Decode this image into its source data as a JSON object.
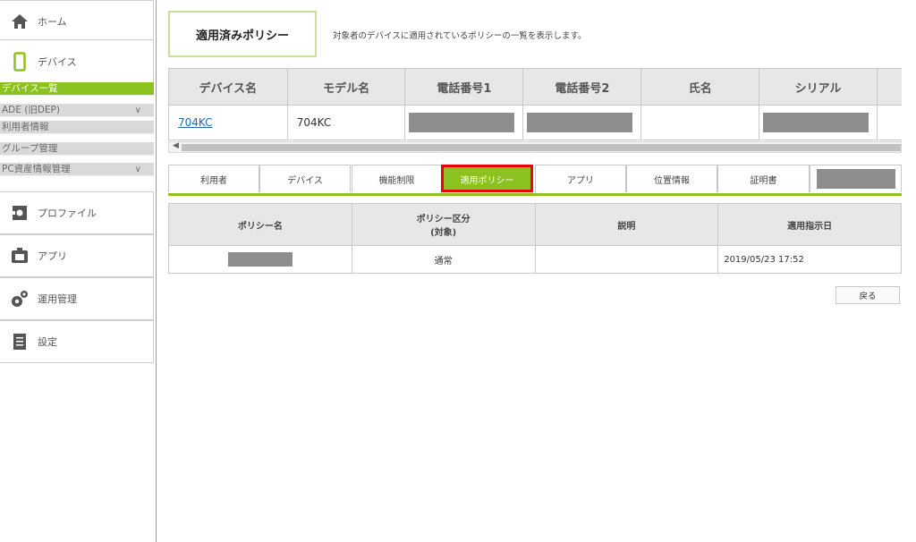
{
  "sidebar": {
    "home": "ホーム",
    "device": "デバイス",
    "sub_items": [
      {
        "label": "デバイス一覧",
        "active": true,
        "chevron": false
      },
      {
        "label": "ADE (旧DEP)",
        "active": false,
        "chevron": true
      },
      {
        "label": "利用者情報",
        "active": false,
        "chevron": false
      },
      {
        "label": "グループ管理",
        "active": false,
        "chevron": false
      },
      {
        "label": "PC資産情報管理",
        "active": false,
        "chevron": true
      }
    ],
    "profile": "プロファイル",
    "app": "アプリ",
    "operation": "運用管理",
    "settings": "設定"
  },
  "header": {
    "title": "適用済みポリシー",
    "description": "対象者のデバイスに適用されているポリシーの一覧を表示します。"
  },
  "device_table": {
    "columns": [
      "デバイス名",
      "モデル名",
      "電話番号1",
      "電話番号2",
      "氏名",
      "シリアル"
    ],
    "row": {
      "device_name": "704KC",
      "model_name": "704KC",
      "phone1": "",
      "phone2": "",
      "name": "",
      "serial": ""
    }
  },
  "tabs": [
    {
      "label": "利用者",
      "active": false
    },
    {
      "label": "デバイス",
      "active": false
    },
    {
      "label": "機能制限",
      "active": false
    },
    {
      "label": "適用ポリシー",
      "active": true
    },
    {
      "label": "アプリ",
      "active": false
    },
    {
      "label": "位置情報",
      "active": false
    },
    {
      "label": "証明書",
      "active": false
    }
  ],
  "policy_table": {
    "columns": [
      "ポリシー名",
      "ポリシー区分",
      "(対象)",
      "説明",
      "適用指示日"
    ],
    "row": {
      "policy_name": "",
      "category": "通常",
      "description": "",
      "date": "2019/05/23 17:52"
    }
  },
  "back_button": "戻る",
  "colors": {
    "accent": "#8cc21f",
    "highlight": "#e00000",
    "mask": "#8d8d8d"
  }
}
